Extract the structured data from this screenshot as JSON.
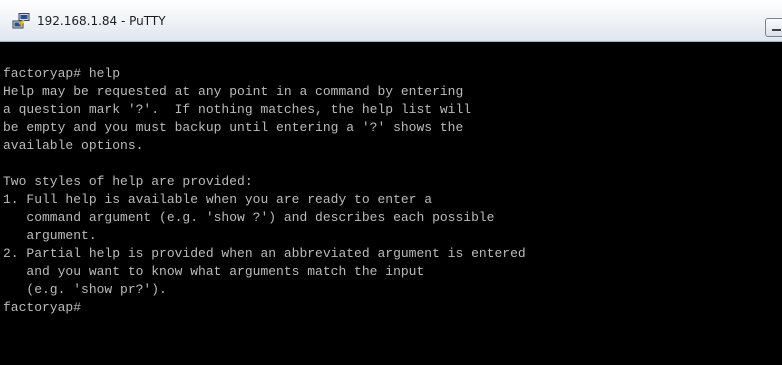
{
  "window": {
    "title": "192.168.1.84 - PuTTY",
    "icon": "putty-icon"
  },
  "terminal": {
    "lines": [
      "factoryap# help",
      "Help may be requested at any point in a command by entering",
      "a question mark '?'.  If nothing matches, the help list will",
      "be empty and you must backup until entering a '?' shows the",
      "available options.",
      "",
      "Two styles of help are provided:",
      "1. Full help is available when you are ready to enter a",
      "   command argument (e.g. 'show ?') and describes each possible",
      "   argument.",
      "2. Partial help is provided when an abbreviated argument is entered",
      "   and you want to know what arguments match the input",
      "   (e.g. 'show pr?').",
      "factoryap#"
    ]
  },
  "colors": {
    "terminal_background": "#000000",
    "terminal_text": "#bbbbbb"
  }
}
